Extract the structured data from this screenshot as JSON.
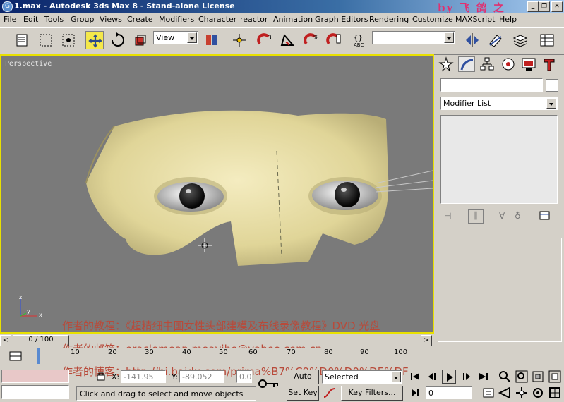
{
  "window": {
    "title": "1.max - Autodesk 3ds Max 8  - Stand-alone License",
    "watermark": "by 飞 鸽 之"
  },
  "menu": [
    "File",
    "Edit",
    "Tools",
    "Group",
    "Views",
    "Create",
    "Modifiers",
    "Character",
    "reactor",
    "Animation",
    "Graph Editors",
    "Rendering",
    "Customize",
    "MAXScript",
    "Help"
  ],
  "toolbar": {
    "ref_coord": "View",
    "named_selection": ""
  },
  "viewport": {
    "label": "Perspective",
    "axis_labels": {
      "x": "x",
      "y": "y",
      "z": "z"
    },
    "border_color": "#e8e000"
  },
  "command_panel": {
    "object_name": "",
    "modifier_list": "Modifier List"
  },
  "overlay_text": {
    "line1": "作者的教程：《超精细中国女性头部建模及布线录像教程》DVD 光盘",
    "line2": "作者的邮箱：oraclemean.meayihe@yahoo.com.cn",
    "line3": "作者的博客：http://hi.baidu.com/prima%B7%C9%D0%D0%D5%DF"
  },
  "timeline": {
    "frame_counter": "0 / 100",
    "ticks": [
      "0",
      "10",
      "20",
      "30",
      "40",
      "50",
      "60",
      "70",
      "80",
      "90",
      "100"
    ]
  },
  "status": {
    "x_label": "X:",
    "x_value": "-141.95",
    "y_label": "Y:",
    "y_value": "-89.052",
    "z_value": "0.0",
    "prompt": "Click and drag to select and move objects",
    "auto_key": "Auto Key",
    "set_key": "Set Key",
    "selected": "Selected",
    "key_filters": "Key Filters...",
    "frame_field": "0"
  }
}
